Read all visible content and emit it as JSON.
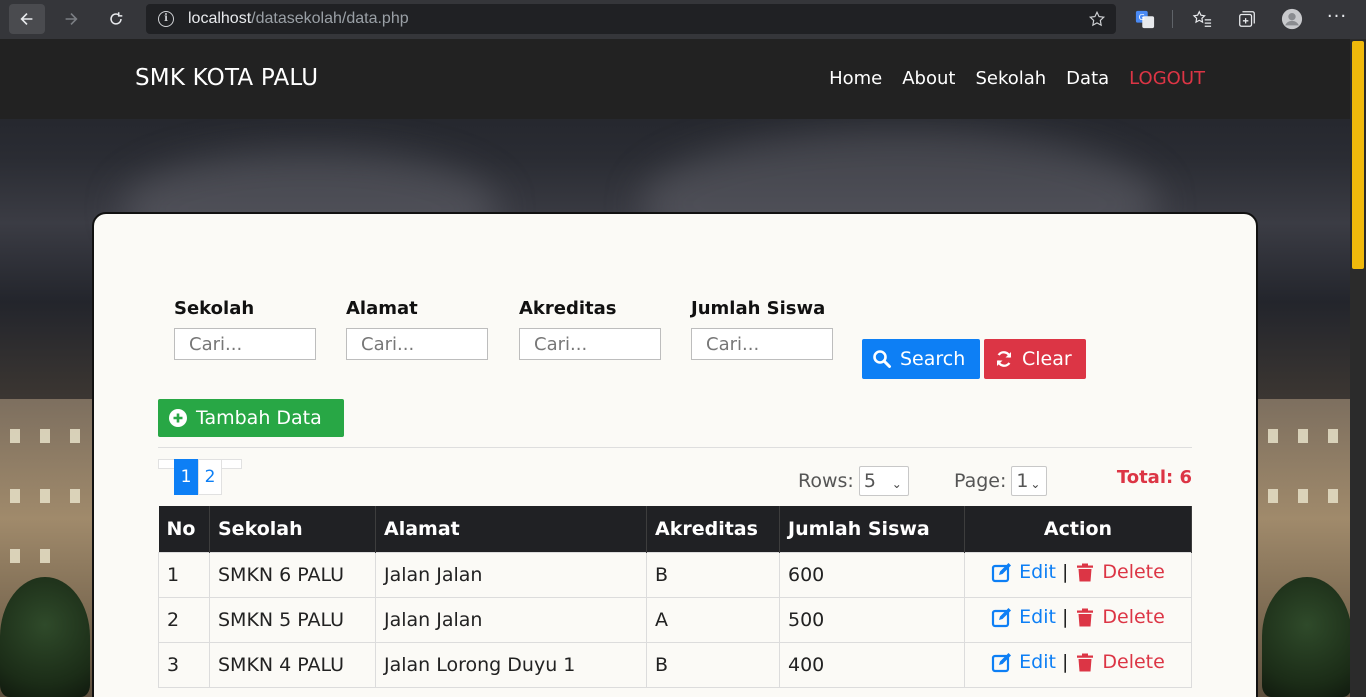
{
  "browser": {
    "url_host": "localhost",
    "url_path": "/datasekolah/data.php"
  },
  "navbar": {
    "brand": "SMK KOTA PALU",
    "items": [
      {
        "label": "Home"
      },
      {
        "label": "About"
      },
      {
        "label": "Sekolah"
      },
      {
        "label": "Data"
      },
      {
        "label": "LOGOUT"
      }
    ]
  },
  "filters": {
    "sekolah": {
      "label": "Sekolah",
      "placeholder": "Cari..."
    },
    "alamat": {
      "label": "Alamat",
      "placeholder": "Cari..."
    },
    "akreditas": {
      "label": "Akreditas",
      "placeholder": "Cari..."
    },
    "jumlah": {
      "label": "Jumlah Siswa",
      "placeholder": "Cari..."
    }
  },
  "buttons": {
    "search": "Search",
    "clear": "Clear",
    "add": "Tambah Data"
  },
  "pagination": {
    "pages": [
      "1",
      "2"
    ],
    "active": "1"
  },
  "controls": {
    "rows_label": "Rows:",
    "rows_value": "5",
    "page_label": "Page:",
    "page_value": "1",
    "total": "Total: 6"
  },
  "table": {
    "headers": {
      "no": "No",
      "sekolah": "Sekolah",
      "alamat": "Alamat",
      "akreditas": "Akreditas",
      "jumlah": "Jumlah Siswa",
      "action": "Action"
    },
    "rows": [
      {
        "no": "1",
        "sekolah": "SMKN 6 PALU",
        "alamat": "Jalan Jalan",
        "akreditas": "B",
        "jumlah": "600"
      },
      {
        "no": "2",
        "sekolah": "SMKN 5 PALU",
        "alamat": "Jalan Jalan",
        "akreditas": "A",
        "jumlah": "500"
      },
      {
        "no": "3",
        "sekolah": "SMKN 4 PALU",
        "alamat": "Jalan Lorong Duyu 1",
        "akreditas": "B",
        "jumlah": "400"
      }
    ],
    "edit_label": "Edit",
    "delete_label": "Delete",
    "separator": "|"
  },
  "colors": {
    "primary": "#0d7ff5",
    "danger": "#dc3545",
    "success": "#28a745",
    "navbar": "#222222",
    "scroll_thumb": "#f0b90b"
  }
}
